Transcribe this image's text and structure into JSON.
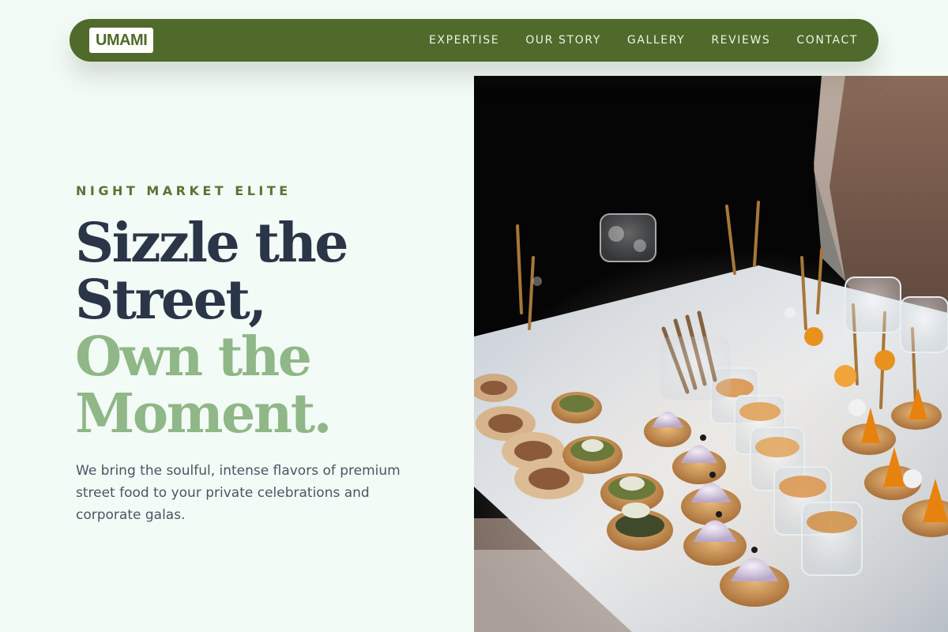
{
  "brand": {
    "logo": "UMAMI"
  },
  "nav": {
    "items": [
      {
        "label": "EXPERTISE"
      },
      {
        "label": "OUR STORY"
      },
      {
        "label": "GALLERY"
      },
      {
        "label": "REVIEWS"
      },
      {
        "label": "CONTACT"
      }
    ]
  },
  "hero": {
    "eyebrow": "NIGHT MARKET ELITE",
    "headline_lines": [
      "Sizzle the",
      "Street,",
      "Own the",
      "Moment."
    ],
    "description": "We bring the soulful, intense flavors of premium street food to your private celebrations and corporate galas.",
    "image_icon": "catering-platter-photo"
  },
  "colors": {
    "nav_bg": "#4f6a2a",
    "page_bg": "#f3fbf6",
    "headline_dark": "#2b3548",
    "headline_accent": "#8fb787",
    "eyebrow": "#5a7335"
  }
}
